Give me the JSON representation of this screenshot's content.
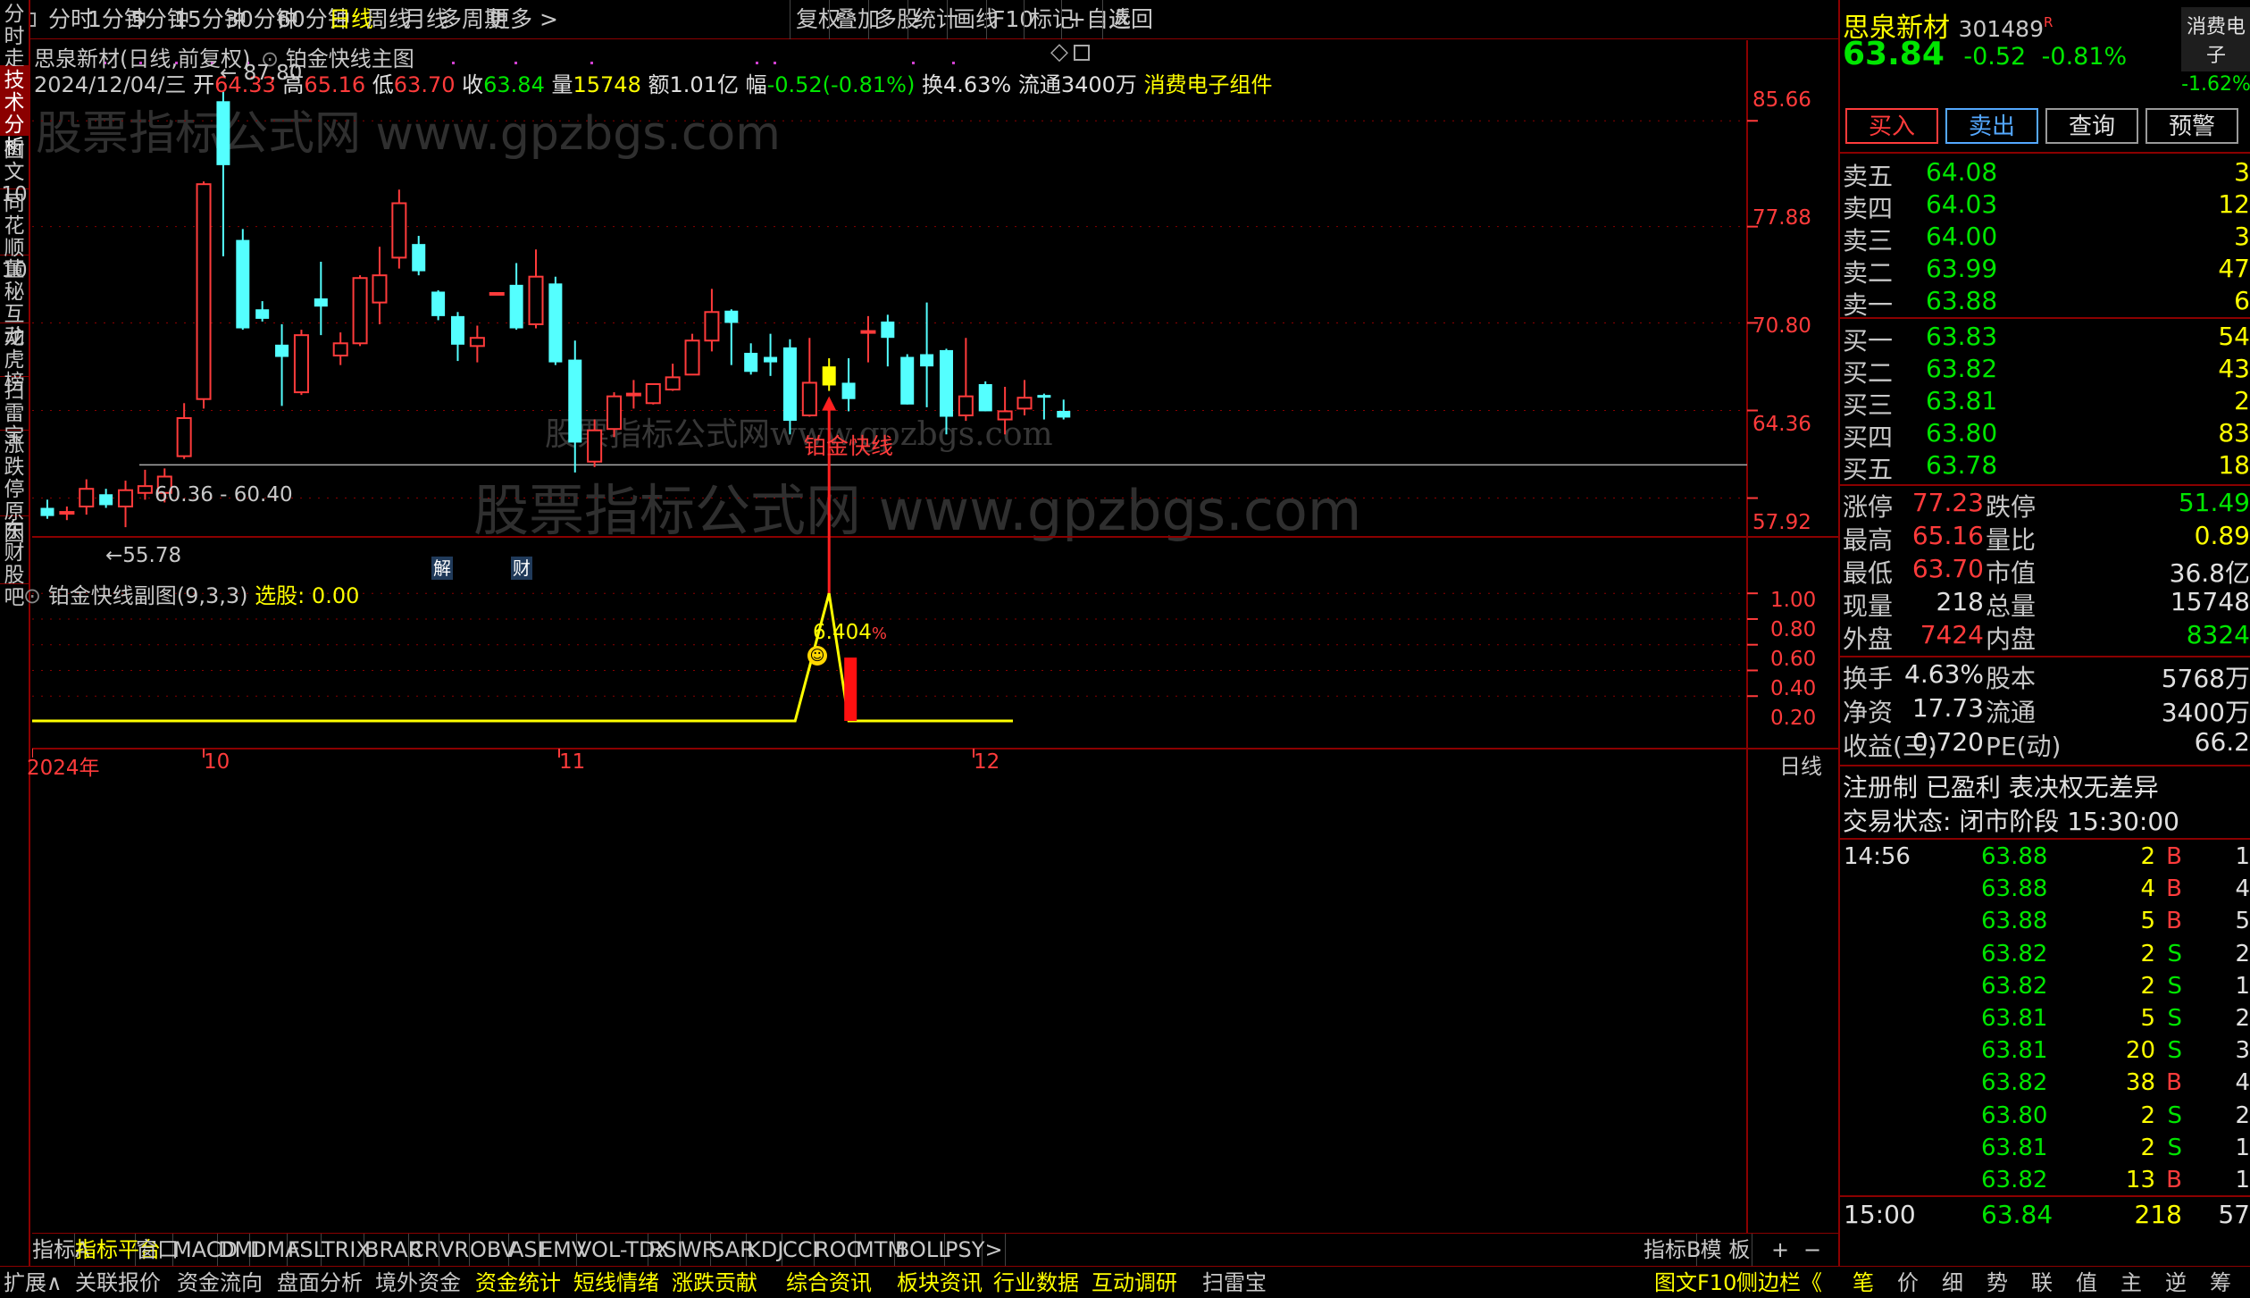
{
  "topbar": {
    "left_icon": "■",
    "period_tabs": [
      "分时",
      "1分钟",
      "5分钟",
      "15分钟",
      "30分钟",
      "60分钟",
      "日线",
      "周线",
      "月线",
      "多周期",
      "更多 >"
    ],
    "active_tab": "日线",
    "right_tools": [
      "复权",
      "叠加",
      "多股",
      "统计",
      "画线",
      "F10",
      "标记",
      "+自选",
      "返回"
    ]
  },
  "leftnav": [
    "分时走势",
    "技术分析",
    "图文10",
    "同花顺10",
    "董秘互动",
    "龙虎榜",
    "扫雷宝",
    "涨跌停原因",
    "东财股吧"
  ],
  "chart": {
    "title": "思泉新材(日线,前复权)",
    "main_indicator": "铂金快线主图",
    "ohlc": {
      "date": "2024/12/04/三",
      "open_label": "开",
      "open": "64.33",
      "high_label": "高",
      "high": "65.16",
      "low_label": "低",
      "low": "63.70",
      "close_label": "收",
      "close": "63.84",
      "vol_label": "量",
      "vol": "15748",
      "amt_label": "额",
      "amt": "1.01亿",
      "chg_label": "幅",
      "chg": "-0.52(-0.81%)",
      "turn_label": "换",
      "turn": "4.63%",
      "float_label": "流通",
      "float": "3400万",
      "sector": "消费电子组件"
    },
    "y_axis": [
      "85.66",
      "77.88",
      "70.80",
      "64.36",
      "57.92"
    ],
    "high_mark": "87.80",
    "low_mark": "←55.78",
    "level_label": "60.36 - 60.40",
    "signal_label": "铂金快线",
    "event_marks": [
      "解",
      "财"
    ],
    "x_axis": [
      "2024年",
      "10",
      "11",
      "12"
    ],
    "watermarks": [
      "股票指标公式网  www.gpzbgs.com",
      "股票指标公式网www.gpzbgs.com",
      "股票指标公式网  www.gpzbgs.com"
    ],
    "sub_title": "铂金快线副图(9,3,3)",
    "sub_value_label": "选股:",
    "sub_value": "0.00",
    "sub_y_axis": [
      "1.00",
      "0.80",
      "0.60",
      "0.40",
      "0.20"
    ],
    "sub_pct": "6.404",
    "sub_pct_unit": "%",
    "corner_label": "日线"
  },
  "chart_data": {
    "type": "candlestick",
    "title": "思泉新材(日线,前复权)",
    "ylim": [
      55.0,
      88.5
    ],
    "candles": [
      {
        "o": 57.2,
        "h": 57.8,
        "l": 56.4,
        "c": 56.6
      },
      {
        "o": 56.8,
        "h": 57.3,
        "l": 56.3,
        "c": 56.9
      },
      {
        "o": 57.3,
        "h": 59.3,
        "l": 56.7,
        "c": 58.6
      },
      {
        "o": 58.2,
        "h": 58.6,
        "l": 57.2,
        "c": 57.4
      },
      {
        "o": 57.3,
        "h": 59.2,
        "l": 55.78,
        "c": 58.5
      },
      {
        "o": 58.3,
        "h": 60.0,
        "l": 57.8,
        "c": 58.8
      },
      {
        "o": 58.3,
        "h": 60.1,
        "l": 57.6,
        "c": 59.5
      },
      {
        "o": 61.0,
        "h": 64.9,
        "l": 60.8,
        "c": 63.8
      },
      {
        "o": 65.2,
        "h": 81.2,
        "l": 64.5,
        "c": 81.0
      },
      {
        "o": 87.1,
        "h": 87.8,
        "l": 75.7,
        "c": 82.4
      },
      {
        "o": 76.9,
        "h": 77.7,
        "l": 70.3,
        "c": 70.4
      },
      {
        "o": 71.8,
        "h": 72.4,
        "l": 70.9,
        "c": 71.1
      },
      {
        "o": 69.2,
        "h": 70.7,
        "l": 64.7,
        "c": 68.3
      },
      {
        "o": 65.7,
        "h": 70.3,
        "l": 65.5,
        "c": 69.9
      },
      {
        "o": 72.6,
        "h": 75.3,
        "l": 69.9,
        "c": 72.0
      },
      {
        "o": 68.4,
        "h": 70.1,
        "l": 67.7,
        "c": 69.3
      },
      {
        "o": 69.3,
        "h": 74.3,
        "l": 69.1,
        "c": 74.1
      },
      {
        "o": 72.3,
        "h": 76.4,
        "l": 70.7,
        "c": 74.3
      },
      {
        "o": 75.6,
        "h": 80.6,
        "l": 74.8,
        "c": 79.6
      },
      {
        "o": 76.6,
        "h": 77.2,
        "l": 74.3,
        "c": 74.6
      },
      {
        "o": 73.1,
        "h": 73.2,
        "l": 71.0,
        "c": 71.3
      },
      {
        "o": 71.3,
        "h": 71.6,
        "l": 68.0,
        "c": 69.2
      },
      {
        "o": 69.1,
        "h": 70.6,
        "l": 67.9,
        "c": 69.7
      },
      {
        "o": 73.0,
        "h": 73.0,
        "l": 73.0,
        "c": 73.0
      },
      {
        "o": 73.6,
        "h": 75.2,
        "l": 70.3,
        "c": 70.4
      },
      {
        "o": 70.7,
        "h": 76.2,
        "l": 70.4,
        "c": 74.2
      },
      {
        "o": 73.7,
        "h": 74.2,
        "l": 67.7,
        "c": 67.9
      },
      {
        "o": 68.1,
        "h": 69.5,
        "l": 59.8,
        "c": 62.0
      },
      {
        "o": 60.6,
        "h": 63.7,
        "l": 60.2,
        "c": 62.9
      },
      {
        "o": 63.0,
        "h": 65.7,
        "l": 62.4,
        "c": 65.4
      },
      {
        "o": 65.6,
        "h": 66.6,
        "l": 64.5,
        "c": 65.6
      },
      {
        "o": 64.9,
        "h": 66.3,
        "l": 64.8,
        "c": 66.3
      },
      {
        "o": 65.9,
        "h": 67.8,
        "l": 65.8,
        "c": 66.8
      },
      {
        "o": 67.0,
        "h": 70.0,
        "l": 67.0,
        "c": 69.5
      },
      {
        "o": 69.5,
        "h": 73.3,
        "l": 68.7,
        "c": 71.6
      },
      {
        "o": 71.7,
        "h": 71.8,
        "l": 67.7,
        "c": 70.8
      },
      {
        "o": 68.6,
        "h": 69.3,
        "l": 67.0,
        "c": 67.2
      },
      {
        "o": 68.3,
        "h": 70.0,
        "l": 66.9,
        "c": 67.9
      },
      {
        "o": 69.0,
        "h": 69.6,
        "l": 62.6,
        "c": 63.6
      },
      {
        "o": 64.0,
        "h": 69.7,
        "l": 63.9,
        "c": 66.4
      },
      {
        "o": 66.2,
        "h": 68.2,
        "l": 65.8,
        "c": 67.6
      },
      {
        "o": 66.4,
        "h": 68.2,
        "l": 64.3,
        "c": 65.2
      },
      {
        "o": 70.1,
        "h": 71.3,
        "l": 67.9,
        "c": 70.2
      },
      {
        "o": 70.9,
        "h": 71.4,
        "l": 67.6,
        "c": 69.7
      },
      {
        "o": 68.3,
        "h": 68.5,
        "l": 64.8,
        "c": 64.8
      },
      {
        "o": 68.5,
        "h": 72.3,
        "l": 64.6,
        "c": 67.6
      },
      {
        "o": 68.8,
        "h": 68.9,
        "l": 62.6,
        "c": 63.9
      },
      {
        "o": 64.0,
        "h": 69.7,
        "l": 63.6,
        "c": 65.4
      },
      {
        "o": 66.3,
        "h": 66.5,
        "l": 64.3,
        "c": 64.3
      },
      {
        "o": 63.7,
        "h": 66.1,
        "l": 62.6,
        "c": 64.3
      },
      {
        "o": 64.5,
        "h": 66.6,
        "l": 64.0,
        "c": 65.3
      },
      {
        "o": 65.5,
        "h": 65.6,
        "l": 63.7,
        "c": 65.3
      },
      {
        "o": 64.33,
        "h": 65.16,
        "l": 63.7,
        "c": 63.84
      }
    ],
    "highlight_candle": {
      "index": 40,
      "color": "#ffff00"
    },
    "level_line": 60.36,
    "sub": {
      "type": "line",
      "ylim": [
        0,
        1.05
      ],
      "signal_index": 40,
      "bar_value": 0.5
    }
  },
  "rightpanel": {
    "name": "思泉新材",
    "code": "301489",
    "code_flag": "R",
    "sector_btn": "消费电子",
    "price": "63.84",
    "change": "-0.52",
    "change_pct": "-0.81%",
    "sector_pct": "-1.62%",
    "buttons": [
      "买入",
      "卖出",
      "查询",
      "预警"
    ],
    "asks": [
      {
        "label": "卖五",
        "price": "64.08",
        "vol": "3"
      },
      {
        "label": "卖四",
        "price": "64.03",
        "vol": "12"
      },
      {
        "label": "卖三",
        "price": "64.00",
        "vol": "3"
      },
      {
        "label": "卖二",
        "price": "63.99",
        "vol": "47"
      },
      {
        "label": "卖一",
        "price": "63.88",
        "vol": "6"
      }
    ],
    "bids": [
      {
        "label": "买一",
        "price": "63.83",
        "vol": "54"
      },
      {
        "label": "买二",
        "price": "63.82",
        "vol": "43"
      },
      {
        "label": "买三",
        "price": "63.81",
        "vol": "2"
      },
      {
        "label": "买四",
        "price": "63.80",
        "vol": "83"
      },
      {
        "label": "买五",
        "price": "63.78",
        "vol": "18"
      }
    ],
    "stats": [
      {
        "l1": "涨停",
        "v1": "77.23",
        "c1": "red",
        "l2": "跌停",
        "v2": "51.49",
        "c2": "green"
      },
      {
        "l1": "最高",
        "v1": "65.16",
        "c1": "red",
        "l2": "量比",
        "v2": "0.89",
        "c2": "yellow"
      },
      {
        "l1": "最低",
        "v1": "63.70",
        "c1": "red",
        "l2": "市值",
        "v2": "36.8亿",
        "c2": "white"
      },
      {
        "l1": "现量",
        "v1": "218",
        "c1": "white",
        "l2": "总量",
        "v2": "15748",
        "c2": "white"
      },
      {
        "l1": "外盘",
        "v1": "7424",
        "c1": "red",
        "l2": "内盘",
        "v2": "8324",
        "c2": "green"
      }
    ],
    "stats2": [
      {
        "l1": "换手",
        "v1": "4.63%",
        "l2": "股本",
        "v2": "5768万"
      },
      {
        "l1": "净资",
        "v1": "17.73",
        "l2": "流通",
        "v2": "3400万"
      },
      {
        "l1": "收益(三)",
        "v1": "0.720",
        "l2": "PE(动)",
        "v2": "66.2"
      }
    ],
    "notice1": "注册制 已盈利 表决权无差异",
    "notice2_label": "交易状态:",
    "notice2_value": "闭市阶段 15:30:00",
    "ticks": [
      {
        "t": "14:56",
        "p": "63.88",
        "v": "2",
        "bs": "B",
        "n": "1"
      },
      {
        "t": "",
        "p": "63.88",
        "v": "4",
        "bs": "B",
        "n": "4"
      },
      {
        "t": "",
        "p": "63.88",
        "v": "5",
        "bs": "B",
        "n": "5"
      },
      {
        "t": "",
        "p": "63.82",
        "v": "2",
        "bs": "S",
        "n": "2"
      },
      {
        "t": "",
        "p": "63.82",
        "v": "2",
        "bs": "S",
        "n": "1"
      },
      {
        "t": "",
        "p": "63.81",
        "v": "5",
        "bs": "S",
        "n": "2"
      },
      {
        "t": "",
        "p": "63.81",
        "v": "20",
        "bs": "S",
        "n": "3"
      },
      {
        "t": "",
        "p": "63.82",
        "v": "38",
        "bs": "B",
        "n": "4"
      },
      {
        "t": "",
        "p": "63.80",
        "v": "2",
        "bs": "S",
        "n": "2"
      },
      {
        "t": "",
        "p": "63.81",
        "v": "2",
        "bs": "S",
        "n": "1"
      },
      {
        "t": "",
        "p": "63.82",
        "v": "13",
        "bs": "B",
        "n": "1"
      }
    ],
    "last_tick": {
      "t": "15:00",
      "p": "63.84",
      "v": "218",
      "n": "57"
    }
  },
  "bottombar1": [
    "指标A",
    "指标平台",
    "窗口",
    "MACD",
    "DMI",
    "DMA",
    "FSL",
    "TRIX",
    "BRAR",
    "CR",
    "VR",
    "OBV",
    "ASI",
    "EMV",
    "VOL-TDX",
    "RSI",
    "WR",
    "SAR",
    "KDJ",
    "CCI",
    "ROC",
    "MTM",
    "BOLL",
    "PSY",
    ">",
    "指标B",
    "模 板",
    "+",
    "−"
  ],
  "bottombar2": [
    "扩展∧",
    "关联报价",
    "资金流向",
    "盘面分析",
    "境外资金",
    "资金统计",
    "短线情绪",
    "涨跌贡献",
    "综合资讯",
    "板块资讯",
    "行业数据",
    "互动调研",
    "扫雷宝",
    "图文F10",
    "侧边栏《"
  ],
  "bottombar2_right": [
    "笔",
    "价",
    "细",
    "势",
    "联",
    "值",
    "主",
    "逆",
    "筹"
  ],
  "colors": {
    "up": "#ff3b3b",
    "down": "#54ffff",
    "grid": "#8b0000",
    "highlight": "#ffff00",
    "subline": "#ffff00",
    "bg": "#000000"
  }
}
